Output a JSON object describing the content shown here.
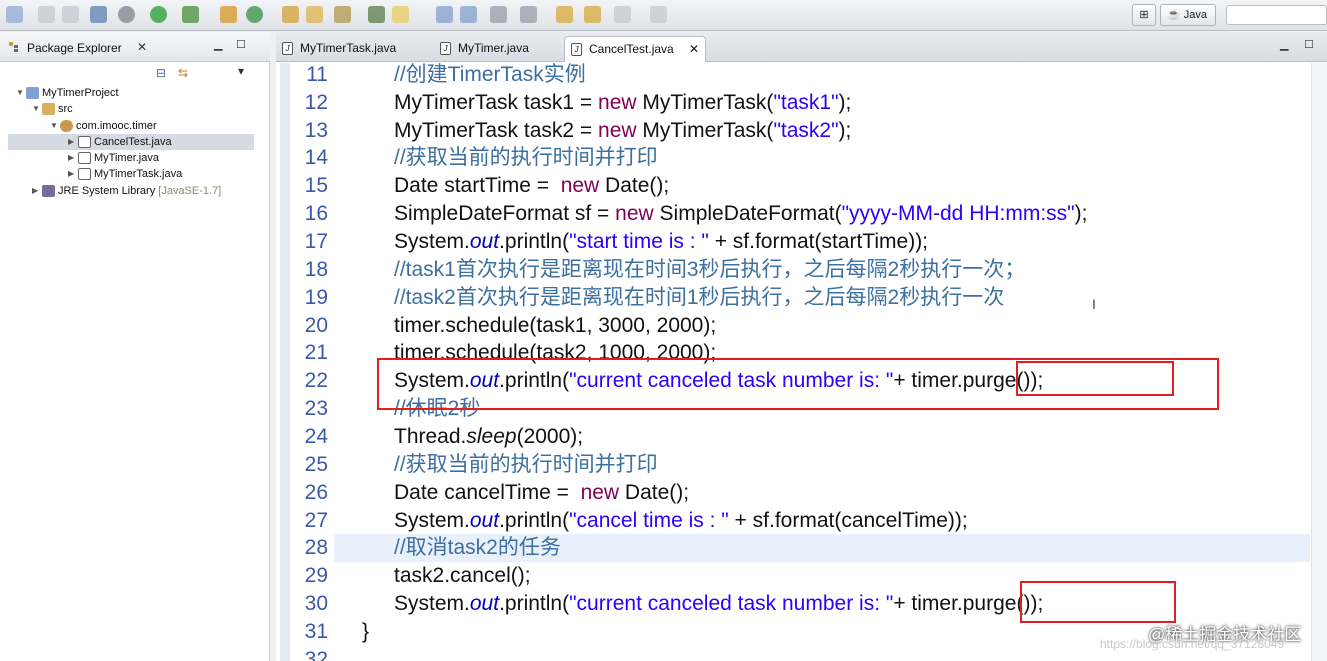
{
  "toolbar": {
    "perspective_label": "Java",
    "icons": [
      "new-icon",
      "save-icon",
      "print-icon",
      "debug-icon",
      "run-icon",
      "coverage-icon",
      "external-tools-icon",
      "new-java-project-icon",
      "open-type-icon",
      "search-icon",
      "back-icon",
      "forward-icon"
    ]
  },
  "package_explorer": {
    "title": "Package Explorer",
    "close_glyph": "✕",
    "tree": [
      {
        "label": "MyTimerProject",
        "level": 0,
        "icon": "project-icon",
        "expanded": true
      },
      {
        "label": "src",
        "level": 1,
        "icon": "source-folder-icon",
        "expanded": true
      },
      {
        "label": "com.imooc.timer",
        "level": 2,
        "icon": "package-icon",
        "expanded": true
      },
      {
        "label": "CancelTest.java",
        "level": 3,
        "icon": "java-file-icon",
        "selected": true
      },
      {
        "label": "MyTimer.java",
        "level": 3,
        "icon": "java-file-icon"
      },
      {
        "label": "MyTimerTask.java",
        "level": 3,
        "icon": "java-file-icon"
      },
      {
        "label": "JRE System Library",
        "decoration": "[JavaSE-1.7]",
        "level": 1,
        "icon": "library-icon"
      }
    ]
  },
  "editor": {
    "tabs": [
      {
        "label": "MyTimerTask.java",
        "active": false
      },
      {
        "label": "MyTimer.java",
        "active": false
      },
      {
        "label": "CancelTest.java",
        "active": true
      }
    ],
    "close_glyph": "✕",
    "current_line": 28,
    "lines": [
      {
        "n": "11",
        "t": "//创建TimerTask实例"
      },
      {
        "n": "12",
        "t": "MyTimerTask task1 = new MyTimerTask(\"task1\");"
      },
      {
        "n": "13",
        "t": "MyTimerTask task2 = new MyTimerTask(\"task2\");"
      },
      {
        "n": "14",
        "t": "//获取当前的执行时间并打印"
      },
      {
        "n": "15",
        "t": "Date startTime =  new Date();"
      },
      {
        "n": "16",
        "t": "SimpleDateFormat sf = new SimpleDateFormat(\"yyyy-MM-dd HH:mm:ss\");"
      },
      {
        "n": "17",
        "t": "System.out.println(\"start time is : \" + sf.format(startTime));"
      },
      {
        "n": "18",
        "t": "//task1首次执行是距离现在时间3秒后执行，之后每隔2秒执行一次；"
      },
      {
        "n": "19",
        "t": "//task2首次执行是距离现在时间1秒后执行，之后每隔2秒执行一次"
      },
      {
        "n": "20",
        "t": "timer.schedule(task1, 3000, 2000);"
      },
      {
        "n": "21",
        "t": "timer.schedule(task2, 1000, 2000);"
      },
      {
        "n": "22",
        "t": "System.out.println(\"current canceled task number is: \"+ timer.purge());"
      },
      {
        "n": "23",
        "t": "//休眠2秒"
      },
      {
        "n": "24",
        "t": "Thread.sleep(2000);"
      },
      {
        "n": "25",
        "t": "//获取当前的执行时间并打印"
      },
      {
        "n": "26",
        "t": "Date cancelTime =  new Date();"
      },
      {
        "n": "27",
        "t": "System.out.println(\"cancel time is : \" + sf.format(cancelTime));"
      },
      {
        "n": "28",
        "t": "//取消task2的任务"
      },
      {
        "n": "29",
        "t": "task2.cancel();"
      },
      {
        "n": "30",
        "t": "System.out.println(\"current canceled task number is: \"+ timer.purge());"
      },
      {
        "n": "31",
        "t": "}"
      },
      {
        "n": "32",
        "t": ""
      }
    ]
  },
  "watermark": {
    "text": "@稀土掘金技术社区",
    "url": "https://blog.csdn.net/qq_37128049"
  },
  "colors": {
    "comment": "#3d6fa0",
    "keyword": "#7f0055",
    "string": "#2a00ff",
    "field": "#0000c0",
    "line_number": "#3a59a8",
    "current_line_bg": "#e8f0fc",
    "annotation_box": "#e02020"
  }
}
